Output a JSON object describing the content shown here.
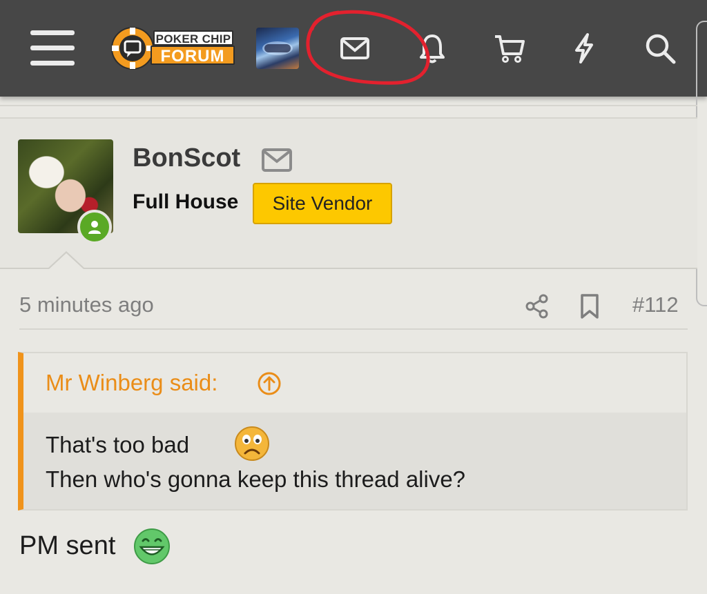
{
  "header": {
    "logo": {
      "line1": "POKER CHIP",
      "line2": "FORUM"
    },
    "icons": [
      "menu-icon",
      "avatar",
      "inbox-icon",
      "bell-icon",
      "cart-icon",
      "bolt-icon",
      "search-icon"
    ]
  },
  "colors": {
    "header_bg": "#474747",
    "page_bg": "#e9e8e3",
    "accent_orange": "#f0931b",
    "badge_yellow": "#fdc800",
    "online_green": "#5aa925",
    "annotation_red": "#e3212e"
  },
  "user": {
    "name": "BonScot",
    "title": "Full House",
    "badge": "Site Vendor"
  },
  "post": {
    "time": "5 minutes ago",
    "number": "#112",
    "quote": {
      "author": "Mr Winberg said:",
      "line1": "That's too bad",
      "line2": "Then who's gonna keep this thread alive?"
    },
    "body": "PM sent"
  }
}
